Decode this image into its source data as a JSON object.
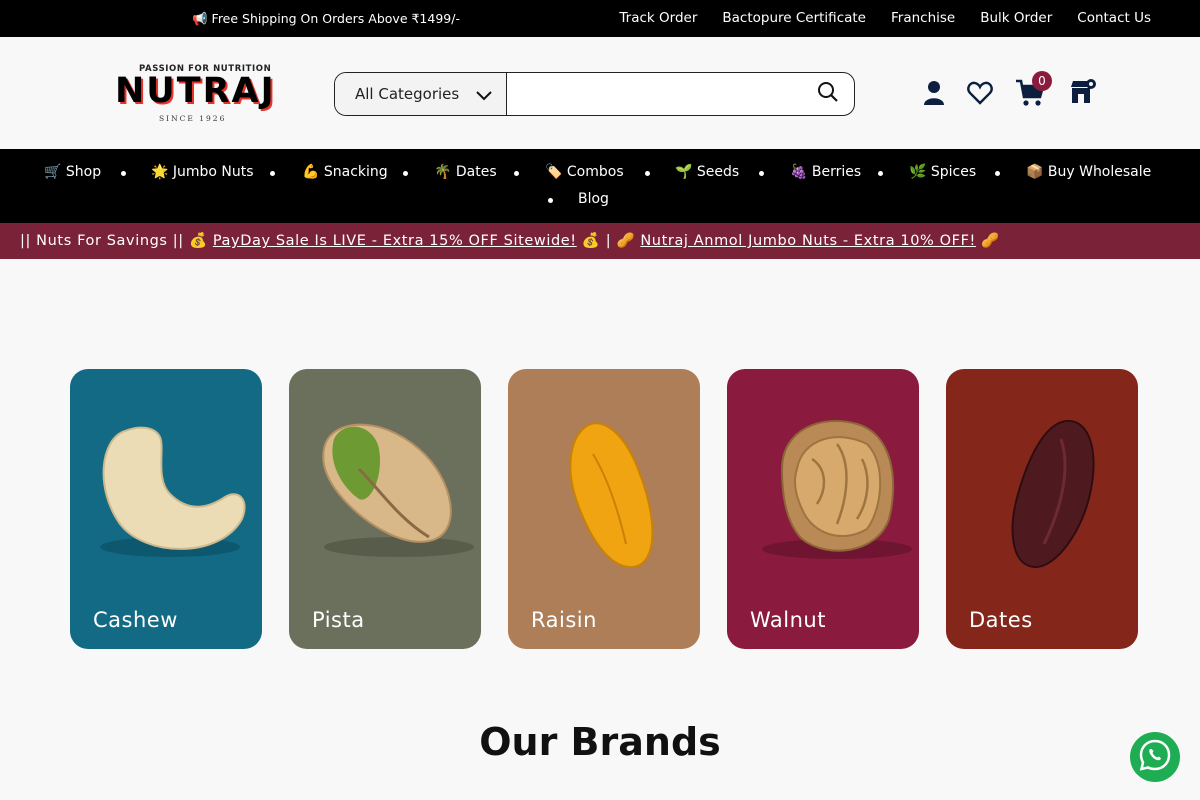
{
  "topbar": {
    "promo": "📢 Free Shipping On Orders Above ₹1499/-",
    "links": [
      "Track Order",
      "Bactopure Certificate",
      "Franchise",
      "Bulk Order",
      "Contact Us"
    ]
  },
  "logo": {
    "tagline": "PASSION FOR NUTRITION",
    "name": "NUTRAJ",
    "since": "SINCE 1926"
  },
  "search": {
    "category": "All Categories",
    "value": "",
    "placeholder": ""
  },
  "header_icons": {
    "account": "user-icon",
    "wishlist": "heart-icon",
    "cart": "cart-icon",
    "cart_count": "0",
    "store": "store-locator-icon"
  },
  "nav": {
    "items": [
      {
        "label": "🛒 Shop"
      },
      {
        "label": "🌟 Jumbo Nuts"
      },
      {
        "label": "💪 Snacking"
      },
      {
        "label": "🌴 Dates"
      },
      {
        "label": "🏷️ Combos"
      },
      {
        "label": "🌱 Seeds"
      },
      {
        "label": "🍇 Berries"
      },
      {
        "label": "🌿 Spices"
      },
      {
        "label": "📦 Buy Wholesale"
      },
      {
        "label": "Blog"
      }
    ]
  },
  "announcement": {
    "prefix": "|| Nuts For Savings || 💰 ",
    "link1": "PayDay Sale Is LIVE - Extra 15% OFF Sitewide!",
    "middle": " 💰 | 🥜 ",
    "link2": "Nutraj Anmol Jumbo Nuts - Extra 10% OFF!",
    "suffix": " 🥜"
  },
  "categories": [
    {
      "label": "Cashew",
      "color": "#136a85"
    },
    {
      "label": "Pista",
      "color": "#6b705c"
    },
    {
      "label": "Raisin",
      "color": "#ad7e58"
    },
    {
      "label": "Walnut",
      "color": "#8a1b3e"
    },
    {
      "label": "Dates",
      "color": "#84271a"
    }
  ],
  "section_title": "Our Brands",
  "colors": {
    "topbar_bg": "#000000",
    "announcement_bg": "#7a2237",
    "badge_bg": "#8b1b3c",
    "whatsapp": "#1fad53"
  }
}
